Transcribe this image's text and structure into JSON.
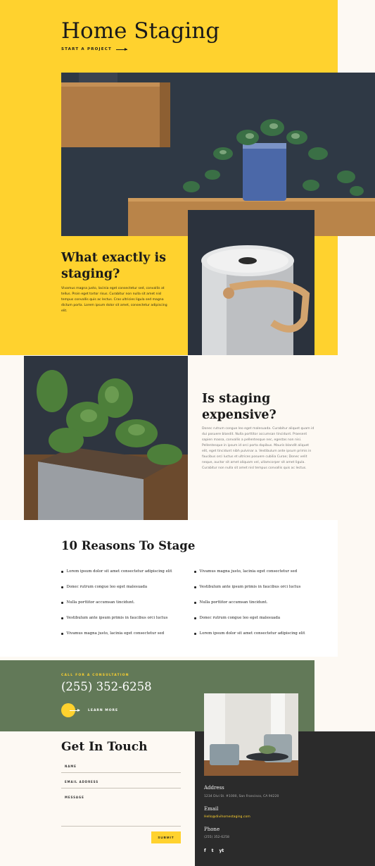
{
  "hero": {
    "title": "Home Staging",
    "cta_label": "START A PROJECT"
  },
  "what_is": {
    "heading_line1": "What exactly is",
    "heading_line2": "staging?",
    "body": "Vivamus magna justo, lacinia eget consectetur sed, convallis at tellus. Proin eget tortor risus. Curabitur non nulla sit amet nisl tempus convallis quis ac lectus. Cras ultricies ligula sed magna dictum porta. Lorem ipsum dolor sit amet, consectetur adipiscing elit."
  },
  "expensive": {
    "heading_line1": "Is staging",
    "heading_line2": "expensive?",
    "body": "Donec rutrum congue leo eget malesuada. Curabitur aliquet quam id dui posuere blandit. Nulla porttitor accumsan tincidunt. Praesent sapien massa, convallis a pellentesque nec, egestas non nisi. Pellentesque in ipsum id orci porta dapibus. Mauris blandit aliquet elit, eget tincidunt nibh pulvinar a. Vestibulum ante ipsum primis in faucibus orci luctus et ultrices posuere cubilia Curae; Donec velit neque, auctor sit amet aliquam vel, ullamcorper sit amet ligula. Curabitur non nulla sit amet nisl tempus convallis quis ac lectus."
  },
  "reasons": {
    "heading": "10 Reasons To Stage",
    "left": [
      "Lorem ipsum dolor sit amet consectetur adipiscing elit",
      "Donec rutrum congue leo eget malesuada",
      "Nulla porttitor accumsan tincidunt.",
      "Vestibulum ante ipsum primis in faucibus orci luctus",
      "Vivamus magna justo, lacinia eget consectetur sed"
    ],
    "right": [
      "Vivamus magna justo, lacinia eget consectetur sed",
      "Vestibulum ante ipsum primis in faucibus orci luctus",
      "Nulla porttitor accumsan tincidunt.",
      "Donec rutrum congue leo eget malesuada",
      "Lorem ipsum dolor sit amet consectetur adipiscing elit"
    ]
  },
  "consultation": {
    "label": "CALL FOR A CONSULTATION",
    "phone": "(255) 352-6258",
    "learn_more": "LEARN MORE"
  },
  "contact": {
    "heading": "Get In Touch",
    "name_label": "NAME",
    "email_label": "EMAIL ADDRESS",
    "message_label": "MESSAGE",
    "submit": "SUBMIT"
  },
  "info": {
    "address_label": "Address",
    "address": "1234 Divi St. #1000, San Francisco, CA 94220",
    "email_label": "Email",
    "email": "Hello@divihomestaging.com",
    "phone_label": "Phone",
    "phone": "(255) 352-6258",
    "social": [
      "f",
      "t",
      "yt"
    ]
  },
  "colors": {
    "yellow": "#ffd22e",
    "green": "#627958",
    "dark": "#2b2b2b",
    "cream": "#fdf9f3"
  }
}
